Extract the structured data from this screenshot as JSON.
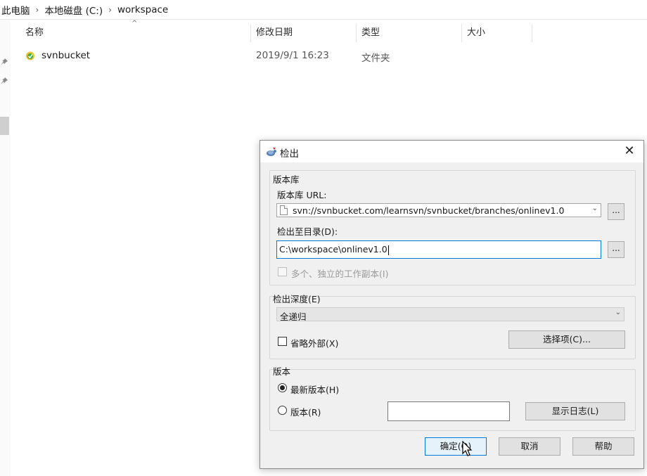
{
  "explorer": {
    "breadcrumb": [
      "此电脑",
      "本地磁盘 (C:)",
      "workspace"
    ],
    "columns": {
      "name": "名称",
      "modified": "修改日期",
      "type": "类型",
      "size": "大小"
    },
    "files": [
      {
        "name": "svnbucket",
        "modified": "2019/9/1 16:23",
        "type": "文件夹"
      }
    ]
  },
  "dialog": {
    "title": "检出",
    "repo_group": "版本库",
    "repo_url_label": "版本库 URL:",
    "repo_url_value": "svn://svnbucket.com/learnsvn/svnbucket/branches/onlinev1.0",
    "checkout_dir_label": "检出至目录(D):",
    "checkout_dir_value": "C:\\workspace\\onlinev1.0",
    "browse_label": "...",
    "multi_wc_label": "多个、独立的工作副本(I)",
    "depth_group": "检出深度(E)",
    "depth_value": "全递归",
    "omit_externals_label": "省略外部(X)",
    "choose_items_label": "选择项(C)...",
    "revision_group": "版本",
    "head_revision_label": "最新版本(H)",
    "revision_label": "版本(R)",
    "revision_value": "",
    "show_log_label": "显示日志(L)",
    "ok_label": "确定(O)",
    "cancel_label": "取消",
    "help_label": "帮助"
  },
  "colors": {
    "accent": "#0078d7",
    "dialog_bg": "#f0f0f0",
    "button_bg": "#e1e1e1"
  },
  "icons": {
    "breadcrumb_sep": "chevron-right-icon",
    "pin": "pin-icon",
    "folder": "svn-folder-icon",
    "title": "tortoisesvn-icon",
    "close": "close-icon",
    "dropdown": "chevron-down-icon",
    "cursor": "mouse-pointer-icon"
  }
}
